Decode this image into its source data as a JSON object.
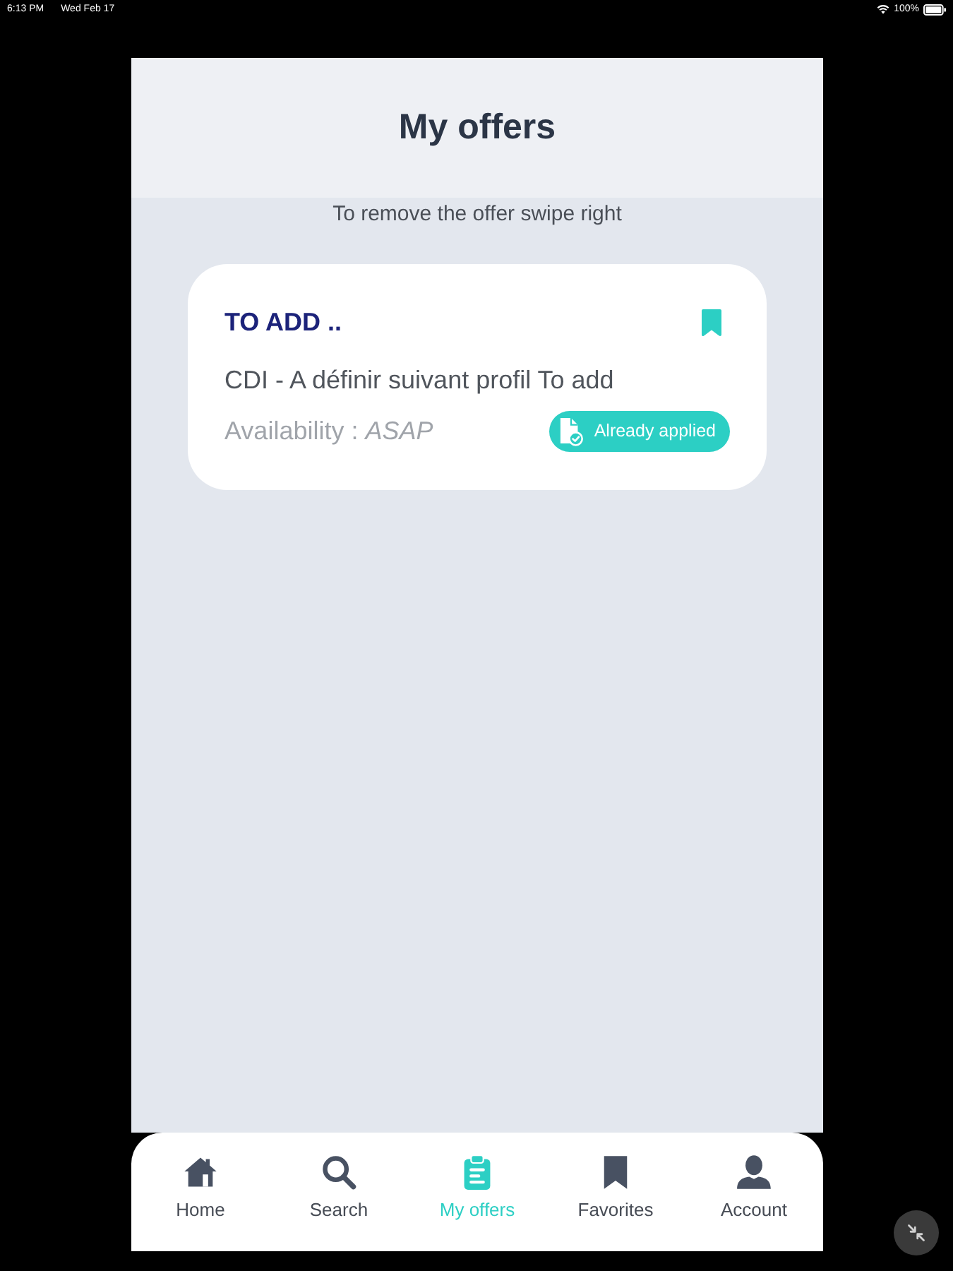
{
  "status_bar": {
    "time": "6:13 PM",
    "date": "Wed Feb 17",
    "battery": "100%"
  },
  "header": {
    "title": "My offers"
  },
  "hint": "To remove the offer swipe right",
  "offers": [
    {
      "title": "TO ADD ..",
      "bookmarked": true,
      "contract": "CDI - A définir suivant profil To add",
      "availability": "Availability : *ASAP*",
      "status": "Already applied"
    }
  ],
  "tab_bar": [
    {
      "kind": "home",
      "label": "Home",
      "selected": false
    },
    {
      "kind": "search",
      "label": "Search",
      "selected": false
    },
    {
      "kind": "offers",
      "label": "My offers",
      "selected": true
    },
    {
      "kind": "favorites",
      "label": "Favorites",
      "selected": false
    },
    {
      "kind": "account",
      "label": "Account",
      "selected": false
    }
  ]
}
